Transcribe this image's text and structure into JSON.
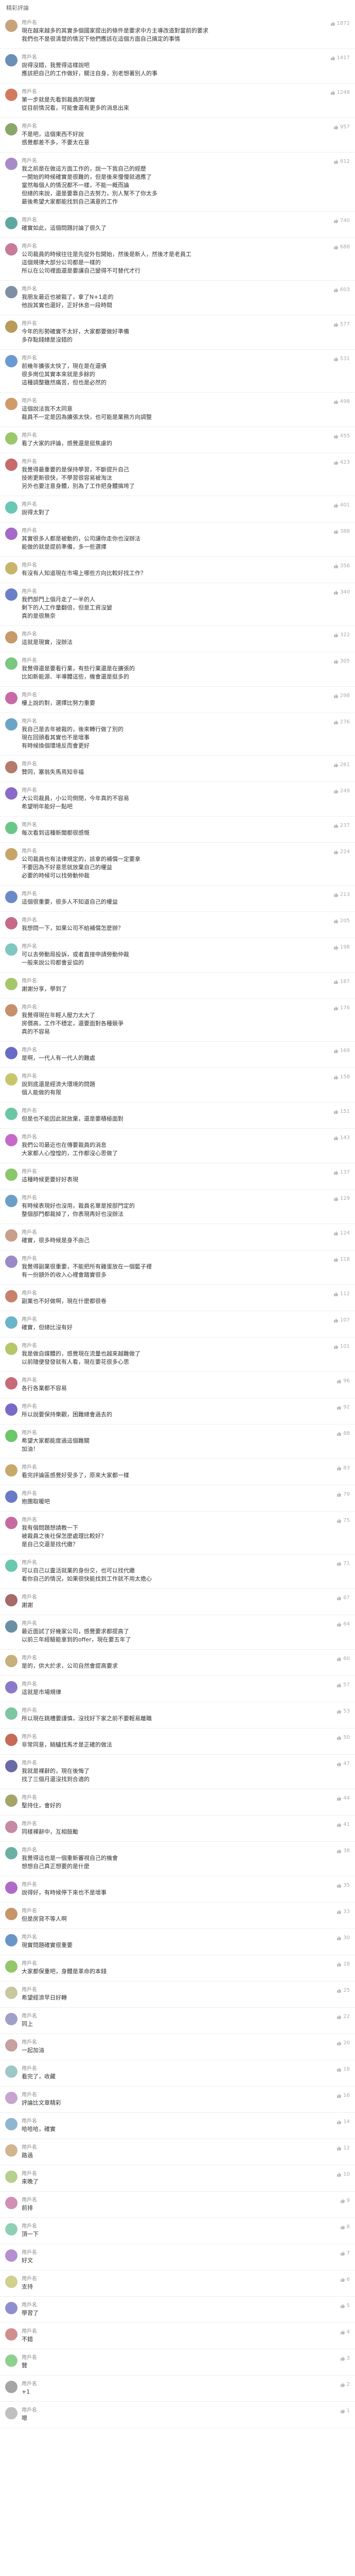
{
  "page_title": "精彩評論",
  "colors": {
    "like": "#aaaaaa",
    "name": "#888888",
    "divider": "#eeeeee"
  },
  "comments": [
    {
      "avatar_color": "#c7a27a",
      "name": "用戶名",
      "likes": "1872",
      "lines": [
        "現在越來越多的其實多個國家提出的條件是要求中方主導改造對當前的要求",
        "我們也不是很清楚的情況下他們應該在這個方面自己搞定的事情"
      ]
    },
    {
      "avatar_color": "#6b8fb5",
      "name": "用戶名",
      "likes": "1417",
      "lines": [
        "說得沒錯，我覺得這樣說吧",
        "應該把自己的工作做好，關注自身，別老想著別人的事"
      ]
    },
    {
      "avatar_color": "#d27a5f",
      "name": "用戶名",
      "likes": "1248",
      "lines": [
        "第一步就是先看到裁員的現實",
        "從目前情況看，可能會還有更多的消息出來"
      ]
    },
    {
      "avatar_color": "#8aa76a",
      "name": "用戶名",
      "likes": "957",
      "lines": [
        "不是吧，這個東西不好說",
        "感覺都差不多，不要太在意"
      ]
    },
    {
      "avatar_color": "#a78bc7",
      "name": "用戶名",
      "likes": "812",
      "lines": [
        "我之前是在做這方面工作的，說一下我自己的經歷",
        "一開始的時候確實是很難的，但是後來慢慢就適應了",
        "當然每個人的情況都不一樣，不能一概而論",
        "但總的來說，還是要靠自己去努力，別人幫不了你太多",
        "最後希望大家都能找到自己滿意的工作"
      ]
    },
    {
      "avatar_color": "#5fa8a0",
      "name": "用戶名",
      "likes": "740",
      "lines": [
        "確實如此，這個問題討論了很久了"
      ]
    },
    {
      "avatar_color": "#c77a9a",
      "name": "用戶名",
      "likes": "688",
      "lines": [
        "公司裁員的時候往往是先從外包開始，然後是新人，然後才是老員工",
        "這個規律大部分公司都是一樣的",
        "所以在公司裡面還是要讓自己變得不可替代才行"
      ]
    },
    {
      "avatar_color": "#7f8fa6",
      "name": "用戶名",
      "likes": "603",
      "lines": [
        "我朋友最近也被裁了，拿了N+1走的",
        "他說其實也還好，正好休息一段時間"
      ]
    },
    {
      "avatar_color": "#b89a5a",
      "name": "用戶名",
      "likes": "577",
      "lines": [
        "今年的形勢確實不太好，大家都要做好準備",
        "多存點錢總是沒錯的"
      ]
    },
    {
      "avatar_color": "#6a9ad1",
      "name": "用戶名",
      "likes": "531",
      "lines": [
        "前幾年擴張太快了，現在是在還債",
        "很多崗位其實本來就是多餘的",
        "這種調整雖然痛苦，但也是必然的"
      ]
    },
    {
      "avatar_color": "#d19a6a",
      "name": "用戶名",
      "likes": "498",
      "lines": [
        "這個說法我不太同意",
        "裁員不一定是因為擴張太快，也可能是業務方向調整"
      ]
    },
    {
      "avatar_color": "#9ac76a",
      "name": "用戶名",
      "likes": "455",
      "lines": [
        "看了大家的評論，感覺還是挺焦慮的"
      ]
    },
    {
      "avatar_color": "#c76a6a",
      "name": "用戶名",
      "likes": "423",
      "lines": [
        "我覺得最重要的是保持學習，不斷提升自己",
        "技術更新很快，不學習很容易被淘汰",
        "另外也要注意身體，別為了工作把身體搞垮了"
      ]
    },
    {
      "avatar_color": "#6ac7b5",
      "name": "用戶名",
      "likes": "401",
      "lines": [
        "說得太對了"
      ]
    },
    {
      "avatar_color": "#a56ac7",
      "name": "用戶名",
      "likes": "388",
      "lines": [
        "其實很多人都是被動的，公司讓你走你也沒辦法",
        "能做的就是提前準備，多一些選擇"
      ]
    },
    {
      "avatar_color": "#c7b56a",
      "name": "用戶名",
      "likes": "356",
      "lines": [
        "有沒有人知道現在市場上哪些方向比較好找工作？"
      ]
    },
    {
      "avatar_color": "#6a7fc7",
      "name": "用戶名",
      "likes": "340",
      "lines": [
        "我們部門上個月走了一半的人",
        "剩下的人工作量翻倍，但是工資沒變",
        "真的是很無奈"
      ]
    },
    {
      "avatar_color": "#c79a6a",
      "name": "用戶名",
      "likes": "322",
      "lines": [
        "這就是現實，沒辦法"
      ]
    },
    {
      "avatar_color": "#7ac77f",
      "name": "用戶名",
      "likes": "305",
      "lines": [
        "我覺得還是要看行業，有些行業還是在擴張的",
        "比如新能源、半導體這些，機會還是挺多的"
      ]
    },
    {
      "avatar_color": "#c76aa5",
      "name": "用戶名",
      "likes": "298",
      "lines": [
        "樓上說的對，選擇比努力重要"
      ]
    },
    {
      "avatar_color": "#6aa5c7",
      "name": "用戶名",
      "likes": "276",
      "lines": [
        "我自己是去年被裁的，後來轉行做了別的",
        "現在回頭看其實也不是壞事",
        "有時候換個環境反而會更好"
      ]
    },
    {
      "avatar_color": "#b57a6a",
      "name": "用戶名",
      "likes": "261",
      "lines": [
        "贊同，塞翁失馬焉知非福"
      ]
    },
    {
      "avatar_color": "#8a6ac7",
      "name": "用戶名",
      "likes": "249",
      "lines": [
        "大公司裁員，小公司倒閉，今年真的不容易",
        "希望明年能好一點吧"
      ]
    },
    {
      "avatar_color": "#6ac78a",
      "name": "用戶名",
      "likes": "237",
      "lines": [
        "每次看到這種新聞都很感慨"
      ]
    },
    {
      "avatar_color": "#c7a56a",
      "name": "用戶名",
      "likes": "224",
      "lines": [
        "公司裁員也有法律規定的，該拿的補償一定要拿",
        "不要因為不好意思就放棄自己的權益",
        "必要的時候可以找勞動仲裁"
      ]
    },
    {
      "avatar_color": "#6a8ac7",
      "name": "用戶名",
      "likes": "213",
      "lines": [
        "這個很重要，很多人不知道自己的權益"
      ]
    },
    {
      "avatar_color": "#c76a8a",
      "name": "用戶名",
      "likes": "205",
      "lines": [
        "我想問一下，如果公司不給補償怎麼辦？"
      ]
    },
    {
      "avatar_color": "#7fc7c0",
      "name": "用戶名",
      "likes": "198",
      "lines": [
        "可以去勞動局投訴，或者直接申請勞動仲裁",
        "一般來說公司都會妥協的"
      ]
    },
    {
      "avatar_color": "#a5c76a",
      "name": "用戶名",
      "likes": "187",
      "lines": [
        "謝謝分享，學到了"
      ]
    },
    {
      "avatar_color": "#c78f6a",
      "name": "用戶名",
      "likes": "176",
      "lines": [
        "我覺得現在年輕人壓力太大了",
        "房價高，工作不穩定，還要面對各種競爭",
        "真的不容易"
      ]
    },
    {
      "avatar_color": "#6a6ac7",
      "name": "用戶名",
      "likes": "169",
      "lines": [
        "是啊，一代人有一代人的難處"
      ]
    },
    {
      "avatar_color": "#c7c76a",
      "name": "用戶名",
      "likes": "158",
      "lines": [
        "說到底還是經濟大環境的問題",
        "個人能做的有限"
      ]
    },
    {
      "avatar_color": "#6ac7a5",
      "name": "用戶名",
      "likes": "151",
      "lines": [
        "但是也不能因此就放棄，還是要積極面對"
      ]
    },
    {
      "avatar_color": "#c76ac7",
      "name": "用戶名",
      "likes": "143",
      "lines": [
        "我們公司最近也在傳要裁員的消息",
        "大家都人心惶惶的，工作都沒心思做了"
      ]
    },
    {
      "avatar_color": "#8ac76a",
      "name": "用戶名",
      "likes": "137",
      "lines": [
        "這種時候更要好好表現"
      ]
    },
    {
      "avatar_color": "#6a9fc7",
      "name": "用戶名",
      "likes": "129",
      "lines": [
        "有時候表現好也沒用，裁員名單是按部門定的",
        "整個部門都裁掉了，你表現再好也沒辦法"
      ]
    },
    {
      "avatar_color": "#c79f8a",
      "name": "用戶名",
      "likes": "124",
      "lines": [
        "確實，很多時候是身不由己"
      ]
    },
    {
      "avatar_color": "#9a8ac7",
      "name": "用戶名",
      "likes": "118",
      "lines": [
        "我覺得副業很重要，不能把所有雞蛋放在一個籃子裡",
        "有一份額外的收入心裡會踏實很多"
      ]
    },
    {
      "avatar_color": "#c7806a",
      "name": "用戶名",
      "likes": "112",
      "lines": [
        "副業也不好做啊，現在什麼都很卷"
      ]
    },
    {
      "avatar_color": "#6ab5c7",
      "name": "用戶名",
      "likes": "107",
      "lines": [
        "確實，但總比沒有好"
      ]
    },
    {
      "avatar_color": "#b5c76a",
      "name": "用戶名",
      "likes": "101",
      "lines": [
        "我是做自媒體的，感覺現在流量也越來越難做了",
        "以前隨便發發就有人看，現在要花很多心思"
      ]
    },
    {
      "avatar_color": "#c76a7a",
      "name": "用戶名",
      "likes": "96",
      "lines": [
        "各行各業都不容易"
      ]
    },
    {
      "avatar_color": "#7a6ac7",
      "name": "用戶名",
      "likes": "92",
      "lines": [
        "所以說要保持樂觀，困難總會過去的"
      ]
    },
    {
      "avatar_color": "#6ac76a",
      "name": "用戶名",
      "likes": "88",
      "lines": [
        "希望大家都能度過這個難關",
        "加油！"
      ]
    },
    {
      "avatar_color": "#c7aa6a",
      "name": "用戶名",
      "likes": "83",
      "lines": [
        "看完評論區感覺好受多了，原來大家都一樣"
      ]
    },
    {
      "avatar_color": "#6a7ac7",
      "name": "用戶名",
      "likes": "79",
      "lines": [
        "抱團取暖吧"
      ]
    },
    {
      "avatar_color": "#c76a9f",
      "name": "用戶名",
      "likes": "75",
      "lines": [
        "我有個問題想請教一下",
        "被裁員之後社保怎麼處理比較好？",
        "是自己交還是找代繳？"
      ]
    },
    {
      "avatar_color": "#6ac7b0",
      "name": "用戶名",
      "likes": "71",
      "lines": [
        "可以自己以靈活就業的身份交，也可以找代繳",
        "看你自己的情況，如果很快能找到工作就不用太擔心"
      ]
    },
    {
      "avatar_color": "#a56a6a",
      "name": "用戶名",
      "likes": "67",
      "lines": [
        "謝謝"
      ]
    },
    {
      "avatar_color": "#6a8fa5",
      "name": "用戶名",
      "likes": "64",
      "lines": [
        "最近面試了好幾家公司，感覺要求都提高了",
        "以前三年經驗能拿到的offer，現在要五年了"
      ]
    },
    {
      "avatar_color": "#c7b07a",
      "name": "用戶名",
      "likes": "60",
      "lines": [
        "是的，供大於求，公司自然會提高要求"
      ]
    },
    {
      "avatar_color": "#8a7ac7",
      "name": "用戶名",
      "likes": "57",
      "lines": [
        "這就是市場規律"
      ]
    },
    {
      "avatar_color": "#7ac7a0",
      "name": "用戶名",
      "likes": "53",
      "lines": [
        "所以現在跳槽要謹慎，沒找好下家之前不要輕易離職"
      ]
    },
    {
      "avatar_color": "#c76a5a",
      "name": "用戶名",
      "likes": "50",
      "lines": [
        "非常同意，騎驢找馬才是正確的做法"
      ]
    },
    {
      "avatar_color": "#6a6aa5",
      "name": "用戶名",
      "likes": "47",
      "lines": [
        "我就是裸辭的，現在後悔了",
        "找了三個月還沒找到合適的"
      ]
    },
    {
      "avatar_color": "#a5a56a",
      "name": "用戶名",
      "likes": "44",
      "lines": [
        "堅持住，會好的"
      ]
    },
    {
      "avatar_color": "#c78aa5",
      "name": "用戶名",
      "likes": "41",
      "lines": [
        "同樣裸辭中，互相鼓勵"
      ]
    },
    {
      "avatar_color": "#6ab0a5",
      "name": "用戶名",
      "likes": "38",
      "lines": [
        "我覺得這也是一個重新審視自己的機會",
        "想想自己真正想要的是什麼"
      ]
    },
    {
      "avatar_color": "#b06ac7",
      "name": "用戶名",
      "likes": "35",
      "lines": [
        "說得好，有時候停下來也不是壞事"
      ]
    },
    {
      "avatar_color": "#c7956a",
      "name": "用戶名",
      "likes": "33",
      "lines": [
        "但是房貸不等人啊"
      ]
    },
    {
      "avatar_color": "#6a95c7",
      "name": "用戶名",
      "likes": "30",
      "lines": [
        "現實問題確實很重要"
      ]
    },
    {
      "avatar_color": "#95c76a",
      "name": "用戶名",
      "likes": "28",
      "lines": [
        "大家都保重吧，身體是革命的本錢"
      ]
    },
    {
      "avatar_color": "#c7c7a0",
      "name": "用戶名",
      "likes": "25",
      "lines": [
        "希望經濟早日好轉"
      ]
    },
    {
      "avatar_color": "#a0a0c7",
      "name": "用戶名",
      "likes": "22",
      "lines": [
        "同上"
      ]
    },
    {
      "avatar_color": "#c7a0a0",
      "name": "用戶名",
      "likes": "20",
      "lines": [
        "一起加油"
      ]
    },
    {
      "avatar_color": "#a0c7c7",
      "name": "用戶名",
      "likes": "18",
      "lines": [
        "看完了，收藏"
      ]
    },
    {
      "avatar_color": "#c7a5d0",
      "name": "用戶名",
      "likes": "16",
      "lines": [
        "評論比文章精彩"
      ]
    },
    {
      "avatar_color": "#8fb5d0",
      "name": "用戶名",
      "likes": "14",
      "lines": [
        "哈哈哈，確實"
      ]
    },
    {
      "avatar_color": "#d0b58f",
      "name": "用戶名",
      "likes": "12",
      "lines": [
        "路過"
      ]
    },
    {
      "avatar_color": "#b5d08f",
      "name": "用戶名",
      "likes": "10",
      "lines": [
        "來晚了"
      ]
    },
    {
      "avatar_color": "#d08fb5",
      "name": "用戶名",
      "likes": "9",
      "lines": [
        "前排"
      ]
    },
    {
      "avatar_color": "#8fd0b5",
      "name": "用戶名",
      "likes": "8",
      "lines": [
        "頂一下"
      ]
    },
    {
      "avatar_color": "#b58fd0",
      "name": "用戶名",
      "likes": "7",
      "lines": [
        "好文"
      ]
    },
    {
      "avatar_color": "#d0d08f",
      "name": "用戶名",
      "likes": "6",
      "lines": [
        "支持"
      ]
    },
    {
      "avatar_color": "#8f8fd0",
      "name": "用戶名",
      "likes": "5",
      "lines": [
        "學習了"
      ]
    },
    {
      "avatar_color": "#d08f8f",
      "name": "用戶名",
      "likes": "4",
      "lines": [
        "不錯"
      ]
    },
    {
      "avatar_color": "#8fd08f",
      "name": "用戶名",
      "likes": "3",
      "lines": [
        "贊"
      ]
    },
    {
      "avatar_color": "#a5a5a5",
      "name": "用戶名",
      "likes": "2",
      "lines": [
        "+1"
      ]
    },
    {
      "avatar_color": "#c0c0c0",
      "name": "用戶名",
      "likes": "1",
      "lines": [
        "嗯"
      ]
    }
  ]
}
